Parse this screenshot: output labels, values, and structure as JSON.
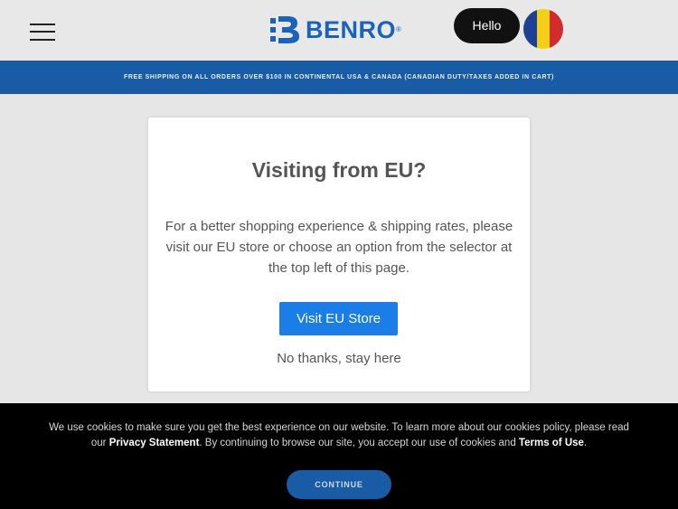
{
  "header": {
    "menu_icon": "hamburger-menu-icon",
    "logo_text": "BENRO",
    "logo_mark": "®",
    "hello_label": "Hello",
    "flag_icon": "romania-flag-icon",
    "flag_colors": [
      "#1f3f93",
      "#f4cf1a",
      "#d12a2f"
    ],
    "brand_color": "#1b63b8"
  },
  "banner": {
    "text": "FREE SHIPPING ON ALL ORDERS OVER $100 IN CONTINENTAL USA & CANADA (CANADIAN DUTY/TAXES ADDED IN CART)"
  },
  "modal": {
    "title": "Visiting from EU?",
    "body": "For a better shopping experience & shipping rates, please visit our EU store or choose an option from the selector at the top left of this page.",
    "primary_button": "Visit EU Store",
    "secondary_link": "No thanks, stay here"
  },
  "cookie": {
    "text_before": "We use cookies to make sure you get the best experience on our website. To learn more about our cookies policy, please read our ",
    "privacy_link": "Privacy Statement",
    "text_middle": ". By continuing to browse our site, you accept our use of cookies and ",
    "terms_link": "Terms of Use",
    "text_after": ".",
    "continue_button": "CONTINUE"
  }
}
